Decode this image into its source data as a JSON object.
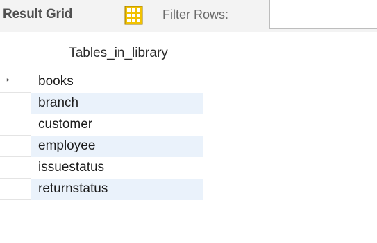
{
  "toolbar": {
    "title": "Result Grid",
    "grid_view_icon": "grid-view-icon",
    "filter_label": "Filter Rows:",
    "filter_value": ""
  },
  "grid": {
    "columns": [
      "Tables_in_library"
    ],
    "rows": [
      [
        "books"
      ],
      [
        "branch"
      ],
      [
        "customer"
      ],
      [
        "employee"
      ],
      [
        "issuestatus"
      ],
      [
        "returnstatus"
      ]
    ],
    "current_row_index": 0
  },
  "colors": {
    "alternate_row": "#eaf2fb",
    "toolbar_bg": "#f3f3f3",
    "icon_yellow": "#f2c200"
  }
}
